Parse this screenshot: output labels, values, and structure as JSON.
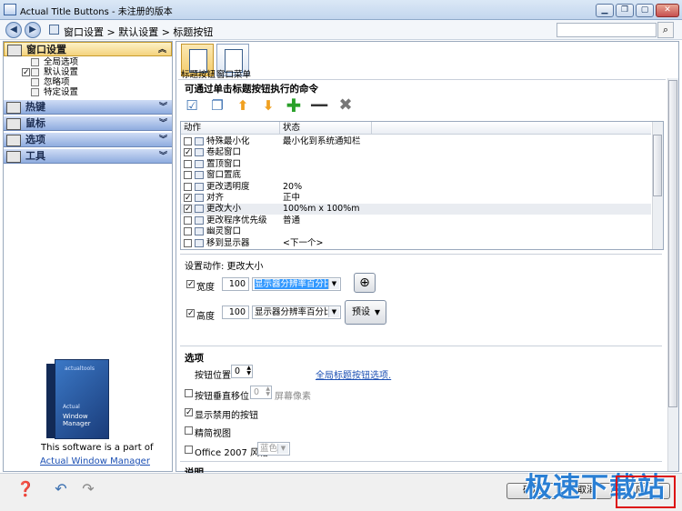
{
  "window": {
    "title": "Actual Title Buttons - 未注册的版本",
    "min": "▁",
    "max": "▢",
    "restore": "❐",
    "close": "✕"
  },
  "address": {
    "back": "◀",
    "forward": "▶",
    "breadcrumb": "窗口设置 > 默认设置 > 标题按钮",
    "search_placeholder": "",
    "search_icon": "search-icon"
  },
  "sidebar": {
    "groups": [
      {
        "label": "窗口设置",
        "chev": "︽"
      },
      {
        "label": "热键",
        "chev": "︾"
      },
      {
        "label": "鼠标",
        "chev": "︾"
      },
      {
        "label": "选项",
        "chev": "︾"
      },
      {
        "label": "工具",
        "chev": "︾"
      }
    ],
    "tree": [
      {
        "label": "全局选项"
      },
      {
        "label": "默认设置",
        "checked": true
      },
      {
        "label": "忽略项"
      },
      {
        "label": "特定设置"
      }
    ],
    "promo_line1": "This software is a part of",
    "promo_link": "Actual Window Manager",
    "box_brand": "actualtools",
    "box_line1": "Actual",
    "box_line2": "Window Manager"
  },
  "tabs": [
    {
      "label": "标题按钮"
    },
    {
      "label": "窗口菜单"
    }
  ],
  "commands": {
    "heading": "可通过单击标题按钮执行的命令",
    "col_action": "动作",
    "col_status": "状态",
    "rows": [
      {
        "name": "特殊最小化",
        "status": "最小化到系统通知栏",
        "checked": false
      },
      {
        "name": "卷起窗口",
        "status": "",
        "checked": true
      },
      {
        "name": "置顶窗口",
        "status": "",
        "checked": false
      },
      {
        "name": "窗口置底",
        "status": "",
        "checked": false
      },
      {
        "name": "更改透明度",
        "status": "20%",
        "checked": false
      },
      {
        "name": "对齐",
        "status": "正中",
        "checked": true
      },
      {
        "name": "更改大小",
        "status": "100%m x 100%m",
        "checked": true
      },
      {
        "name": "更改程序优先级",
        "status": "普通",
        "checked": false
      },
      {
        "name": "幽灵窗口",
        "status": "",
        "checked": false
      },
      {
        "name": "移到显示器",
        "status": "<下一个>",
        "checked": false
      }
    ]
  },
  "action_settings": {
    "heading": "设置动作: 更改大小",
    "width_label": "宽度",
    "width_value": "100",
    "width_unit": "显示器分辨率百分比",
    "height_label": "高度",
    "height_value": "100",
    "height_unit": "显示器分辨率百分比",
    "preset_label": "预设"
  },
  "options": {
    "heading": "选项",
    "button_pos_label": "按钮位置",
    "button_pos_value": "0",
    "global_link": "全局标题按钮选项.",
    "vertical_shift_label": "按钮垂直移位",
    "vertical_shift_value": "0",
    "pixels_label": "屏幕像素",
    "show_disabled_label": "显示禁用的按钮",
    "compact_label": "精简视图",
    "office_style_label": "Office 2007 风格",
    "office_style_value": "蓝色",
    "desc_heading": "说明"
  },
  "footer": {
    "ok": "确定",
    "cancel": "取消",
    "apply": "应用"
  },
  "watermark": "极速下载站",
  "colors": {
    "accent": "#f4cc6a",
    "link": "#1b4fb3",
    "header_blue": "#8facdf"
  }
}
